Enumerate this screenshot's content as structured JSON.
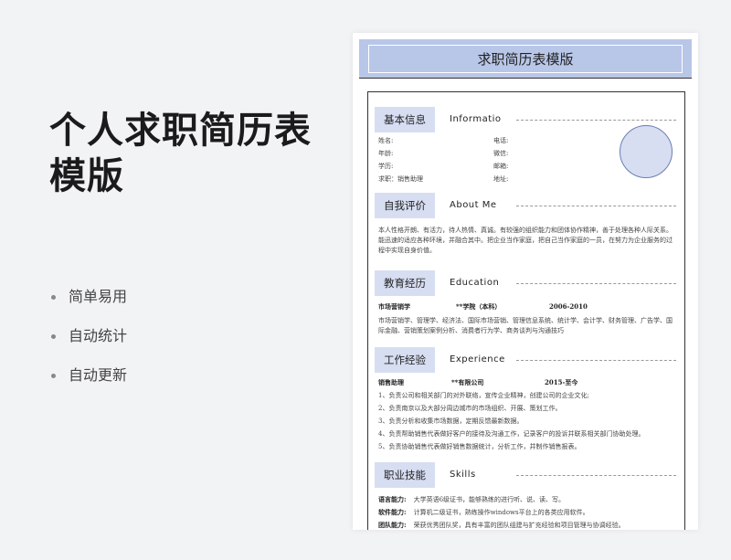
{
  "promo": {
    "title": "个人求职简历表模版",
    "bullets": [
      "简单易用",
      "自动统计",
      "自动更新"
    ]
  },
  "resume": {
    "title": "求职简历表模版",
    "basic": {
      "label": "基本信息",
      "en": "Informatio",
      "left": [
        "姓名:",
        "年龄:",
        "学历:",
        "求职：销售助理"
      ],
      "right": [
        "电话:",
        "微信:",
        "邮箱:",
        "地址:"
      ]
    },
    "about": {
      "label": "自我评价",
      "en": "About Me",
      "text": "本人性格开朗、有活力，待人热情、真诚。有较强的组织能力和团体协作精神，善于处理各种人际关系。能迅速的适应各种环境，并融合其中。把企业当作家庭，把自己当作家庭的一员，在努力为企业服务的过程中实现自身价值。"
    },
    "education": {
      "label": "教育经历",
      "en": "Education",
      "major": "市场营销学",
      "school": "**学院（本科）",
      "period": "2006-2010",
      "text": "市场营销学、管理学、经济法、国际市场营销、管理信息系统、统计学、会计学、财务管理、广告学、国际金融、营销策划案例分析、消费者行为学、商务谈判与沟通技巧"
    },
    "experience": {
      "label": "工作经验",
      "en": "Experience",
      "position": "销售助理",
      "company": "**有限公司",
      "period": "2015-至今",
      "items": [
        "1、负责公司和相关部门的对外联络，宣传企业精神，创建公司的企业文化;",
        "2、负责南京以及大部分周边城市的市场组织、开展、策划工作。",
        "3、负责分析和收集市场数据，定期反馈最新数据。",
        "4、负责帮助销售代表做好客户的接待及沟通工作，记录客户的投诉并联系相关部门协助处理。",
        "5、负责协助销售代表做好销售数据统计，分析工作，并制作销售报表。"
      ]
    },
    "skills": {
      "label": "职业技能",
      "en": "Skills",
      "rows": [
        {
          "k": "语言能力:",
          "v": "大学英语6级证书，能够熟练的进行听、说、读、写。"
        },
        {
          "k": "软件能力:",
          "v": "计算机二级证书，熟练操作windows平台上的各类应用软件。"
        },
        {
          "k": "团队能力:",
          "v": "荣获优秀团队奖，具有丰富的团队组建与扩充经验和项目管理与协调经验。"
        }
      ]
    }
  }
}
